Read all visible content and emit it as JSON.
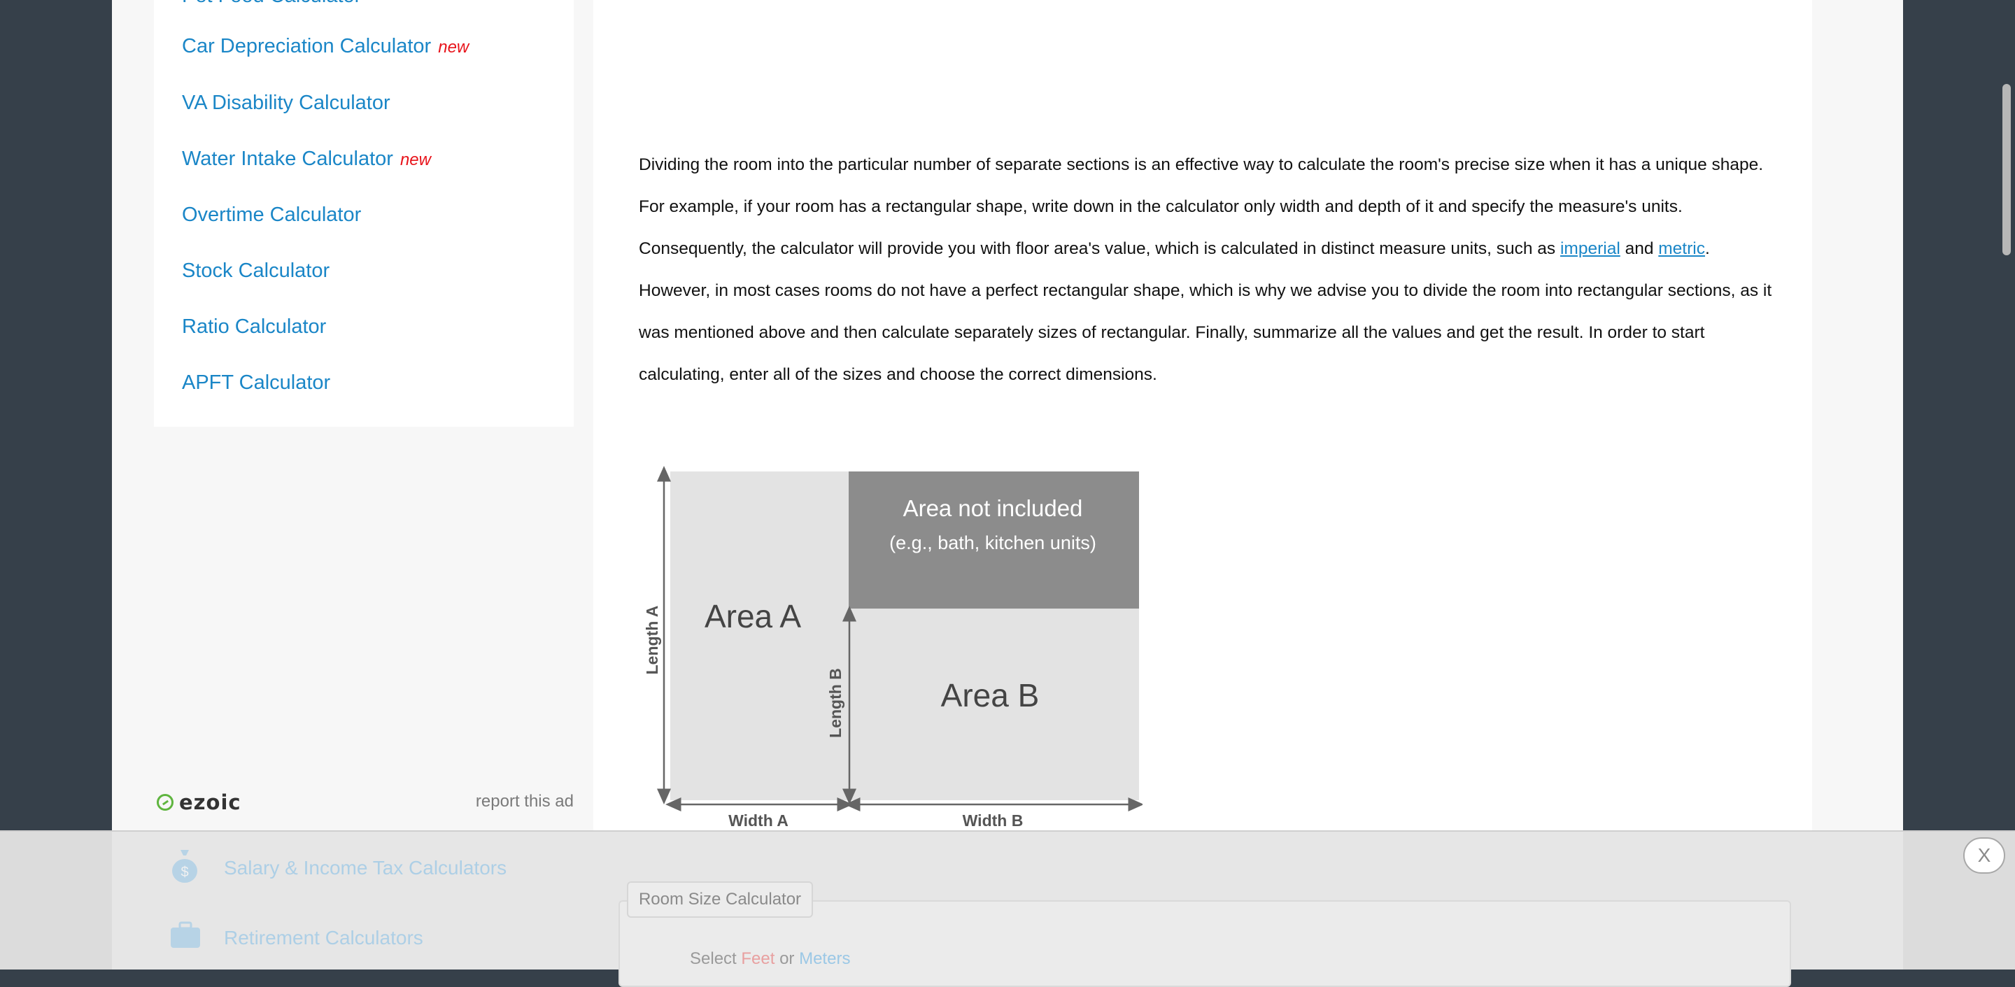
{
  "sidebar": {
    "clipped_item": "Pet Food Calculator",
    "items": [
      {
        "label": "Car Depreciation Calculator",
        "badge": "new"
      },
      {
        "label": "VA Disability Calculator",
        "badge": ""
      },
      {
        "label": "Water Intake Calculator",
        "badge": "new"
      },
      {
        "label": "Overtime Calculator",
        "badge": ""
      },
      {
        "label": "Stock Calculator",
        "badge": ""
      },
      {
        "label": "Ratio Calculator",
        "badge": ""
      },
      {
        "label": "APFT Calculator",
        "badge": ""
      }
    ]
  },
  "ad": {
    "brand": "ezoic",
    "report": "report this ad"
  },
  "article": {
    "p1": "Dividing the room into the particular number of separate sections is an effective way to calculate the room's precise size when it has a unique shape. For example, if your room has a rectangular shape, write down in the calculator only width and depth of it and specify the measure's units. Consequently, the calculator will provide you with floor area's value, which is calculated in distinct measure units, such as ",
    "link_imperial": "imperial",
    "and": " and ",
    "link_metric": "metric",
    "p2": ". However, in most cases rooms do not have a perfect rectangular shape, which is why we advise you to divide the room into rectangular sections, as it was mentioned above and then calculate separately sizes of rectangular. Finally, summarize all the values and get the result. In order to start calculating, enter all of the sizes and choose the correct dimensions."
  },
  "diagram": {
    "area_a": "Area A",
    "area_b": "Area B",
    "not_included_title": "Area not included",
    "not_included_sub": "(e.g., bath, kitchen units)",
    "length_a": "Length A",
    "length_b": "Length B",
    "width_a": "Width A",
    "width_b": "Width B"
  },
  "bottom_bar": {
    "link1": "Salary & Income Tax Calculators",
    "link2": "Retirement Calculators",
    "tab": "Room Size Calculator",
    "select_prefix": "Select ",
    "feet": "Feet",
    "or": " or ",
    "meters": "Meters",
    "close": "X"
  },
  "colors": {
    "link": "#1a86c7",
    "badge": "#e8141b",
    "background": "#36404a"
  }
}
